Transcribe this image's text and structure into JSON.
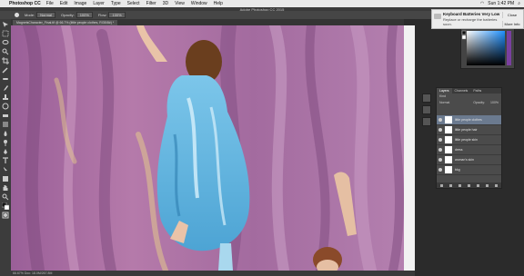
{
  "menubar": {
    "apple_glyph": "",
    "app_name": "Photoshop CC",
    "items": [
      "File",
      "Edit",
      "Image",
      "Layer",
      "Type",
      "Select",
      "Filter",
      "3D",
      "View",
      "Window",
      "Help"
    ],
    "clock": "Sun 1:42 PM"
  },
  "window_title": "Adobe Photoshop CC 2015",
  "options_bar": {
    "mode_label": "Mode:",
    "mode_value": "Normal",
    "opacity_label": "Opacity:",
    "opacity_value": "100%",
    "flow_label": "Flow:",
    "flow_value": "100%"
  },
  "document_tab": "MagnetsCharacter_Final.tif @ 66.7% (little people clothes, RGB/8#) *",
  "status_bar": "66.67%   Doc: 18.0M/267.8M",
  "notification": {
    "title": "Keyboard Batteries Very Low",
    "message": "Replace or recharge the batteries soon.",
    "close_label": "Close",
    "more_label": "More Info"
  },
  "layers_panel": {
    "tabs": [
      "Layers",
      "Channels",
      "Paths"
    ],
    "kind_label": "Kind",
    "blend_mode": "Normal",
    "opacity_label": "Opacity:",
    "opacity_value": "100%",
    "layers": [
      {
        "name": "little people clothes",
        "selected": true
      },
      {
        "name": "little people hair",
        "selected": false
      },
      {
        "name": "little people skin",
        "selected": false
      },
      {
        "name": "dress",
        "selected": false
      },
      {
        "name": "woman's skin",
        "selected": false
      },
      {
        "name": "bkg",
        "selected": false
      }
    ]
  },
  "colors": {
    "accent": "#6b7a8f",
    "fabric": "#a86a9c",
    "dress": "#5fb4dd",
    "hair": "#6a3e1e"
  }
}
